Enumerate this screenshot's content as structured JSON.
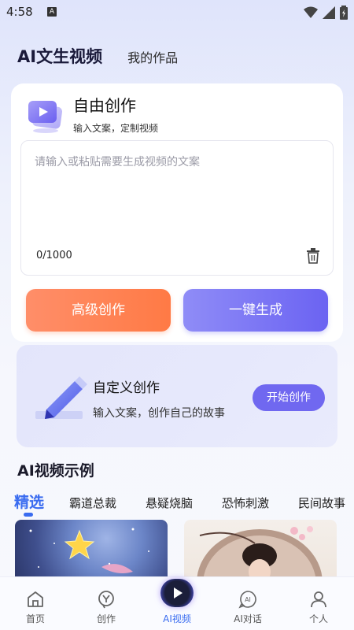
{
  "status_bar": {
    "time": "4:58",
    "badge": "A"
  },
  "header": {
    "tabs": [
      {
        "label": "AI文生视频",
        "active": true
      },
      {
        "label": "我的作品",
        "active": false
      }
    ]
  },
  "free_create": {
    "title": "自由创作",
    "subtitle": "输入文案，定制视频",
    "textarea": {
      "placeholder": "请输入或粘贴需要生成视频的文案",
      "value": "",
      "counter": "0/1000"
    },
    "buttons": {
      "advanced": "高级创作",
      "generate": "一键生成"
    }
  },
  "custom_create": {
    "title": "自定义创作",
    "subtitle": "输入文案，创作自己的故事",
    "start_button": "开始创作"
  },
  "examples": {
    "title": "AI视频示例",
    "categories": [
      "精选",
      "霸道总裁",
      "悬疑烧脑",
      "恐怖刺激",
      "民间故事"
    ],
    "active_category": "精选"
  },
  "bottom_nav": {
    "items": [
      {
        "label": "首页",
        "icon": "home-icon"
      },
      {
        "label": "创作",
        "icon": "create-icon"
      },
      {
        "label": "AI视频",
        "icon": "play-icon",
        "active": true
      },
      {
        "label": "AI对话",
        "icon": "ai-chat-icon"
      },
      {
        "label": "个人",
        "icon": "person-icon"
      }
    ]
  },
  "colors": {
    "accent_blue": "#3a6cf0",
    "orange_button": "#ff7a45",
    "purple_button": "#6b63f2",
    "start_button": "#7068f0"
  }
}
